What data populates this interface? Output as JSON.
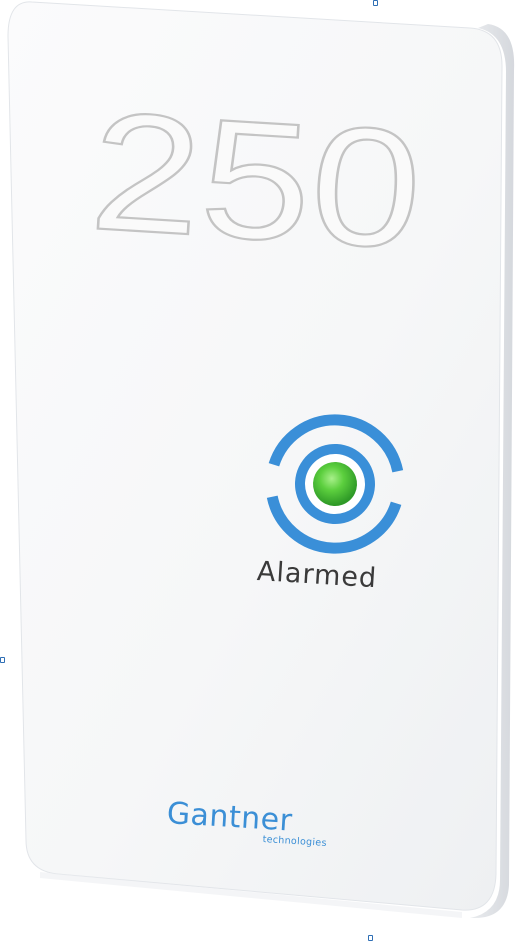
{
  "card": {
    "number": "250",
    "status": "Alarmed",
    "brand": "Gantner",
    "brand_sub": "technologies"
  },
  "colors": {
    "accent_blue": "#3a8fd8",
    "led_green": "#4cc63a",
    "number_outline": "#c4c4c4"
  },
  "icons": {
    "status_indicator": "led-ring-icon"
  }
}
